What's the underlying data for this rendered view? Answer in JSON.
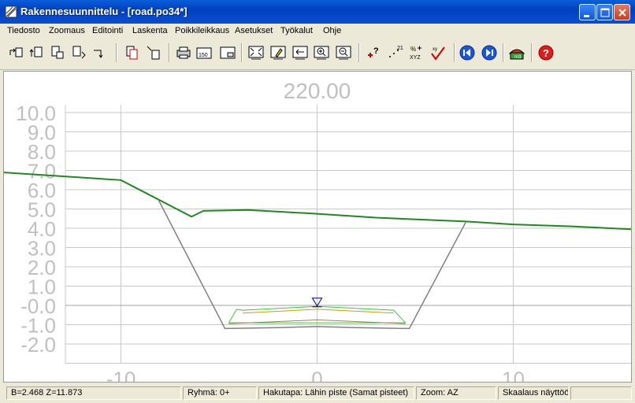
{
  "window": {
    "title": "Rakennesuunnittelu - [road.po34*]"
  },
  "menu": {
    "items": [
      "Tiedosto",
      "Zoomaus",
      "Editointi",
      "Laskenta",
      "Poikkileikkaus",
      "Asetukset",
      "Työkalut",
      "Ohje"
    ]
  },
  "toolbar": {
    "scale_label": "150"
  },
  "chart_data": {
    "type": "line",
    "title": "220.00",
    "xlabel": "",
    "ylabel": "",
    "xlim": [
      -13,
      14.5
    ],
    "ylim": [
      -3.0,
      10.4
    ],
    "x_ticks": [
      -10,
      0,
      10
    ],
    "x_tick_labels": [
      "-10",
      "0",
      "10"
    ],
    "y_ticks": [
      10,
      9,
      8,
      7,
      6,
      5,
      4,
      3,
      2,
      1,
      0,
      -1,
      -2
    ],
    "y_tick_labels": [
      "10.0",
      "9.0",
      "8.0",
      "7.0",
      "6.0",
      "5.0",
      "4.0",
      "3.0",
      "2.0",
      "1.0",
      "-0.0",
      "-1.0",
      "-2.0"
    ],
    "grid": true,
    "reference_line_y": -0.0,
    "marker": {
      "x": 0,
      "y": 0.05
    },
    "colors": {
      "ground": "#1e8a1e",
      "cut_slope": "#808080",
      "layer_green": "#33cc33",
      "layer_yellow": "#c8a200",
      "layer_brown": "#a08060",
      "grid": "#c8c8c8",
      "axis_text": "#c0c0c0",
      "marker": "#000080"
    },
    "series": [
      {
        "role": "ground",
        "x": [
          -16.1,
          -10.0,
          -8.1,
          -6.4,
          -5.8,
          -3.5,
          0.0,
          3.0,
          7.6,
          10.0,
          13.0,
          16.0
        ],
        "y": [
          6.9,
          6.5,
          5.5,
          4.6,
          4.9,
          4.95,
          4.75,
          4.55,
          4.35,
          4.2,
          4.1,
          3.95
        ]
      },
      {
        "role": "cut_slope",
        "x": [
          -8.1,
          -4.7,
          -2.0,
          0.0,
          2.0,
          4.7,
          7.6
        ],
        "y": [
          5.5,
          -1.2,
          -1.15,
          -1.1,
          -1.15,
          -1.2,
          4.35
        ]
      },
      {
        "role": "layer_green",
        "x": [
          -4.1,
          -3.8,
          0.0,
          3.9,
          4.5,
          -4.5,
          -4.1
        ],
        "y": [
          -0.2,
          -0.25,
          -0.05,
          -0.25,
          -0.9,
          -0.9,
          -0.2
        ]
      },
      {
        "role": "layer_yellow",
        "x": [
          -3.8,
          0.0,
          3.9
        ],
        "y": [
          -0.4,
          -0.2,
          -0.4
        ]
      },
      {
        "role": "layer_brown",
        "x": [
          -4.5,
          0.0,
          4.5
        ],
        "y": [
          -0.95,
          -0.75,
          -0.95
        ]
      }
    ]
  },
  "status": {
    "coords": "B=2.468  Z=11.873",
    "group": "Ryhmä: 0+",
    "search_mode": "Hakutapa: Lähin piste (Samat pisteet)",
    "zoom": "Zoom: AZ",
    "scaling": "Skaalaus näyttöön"
  }
}
